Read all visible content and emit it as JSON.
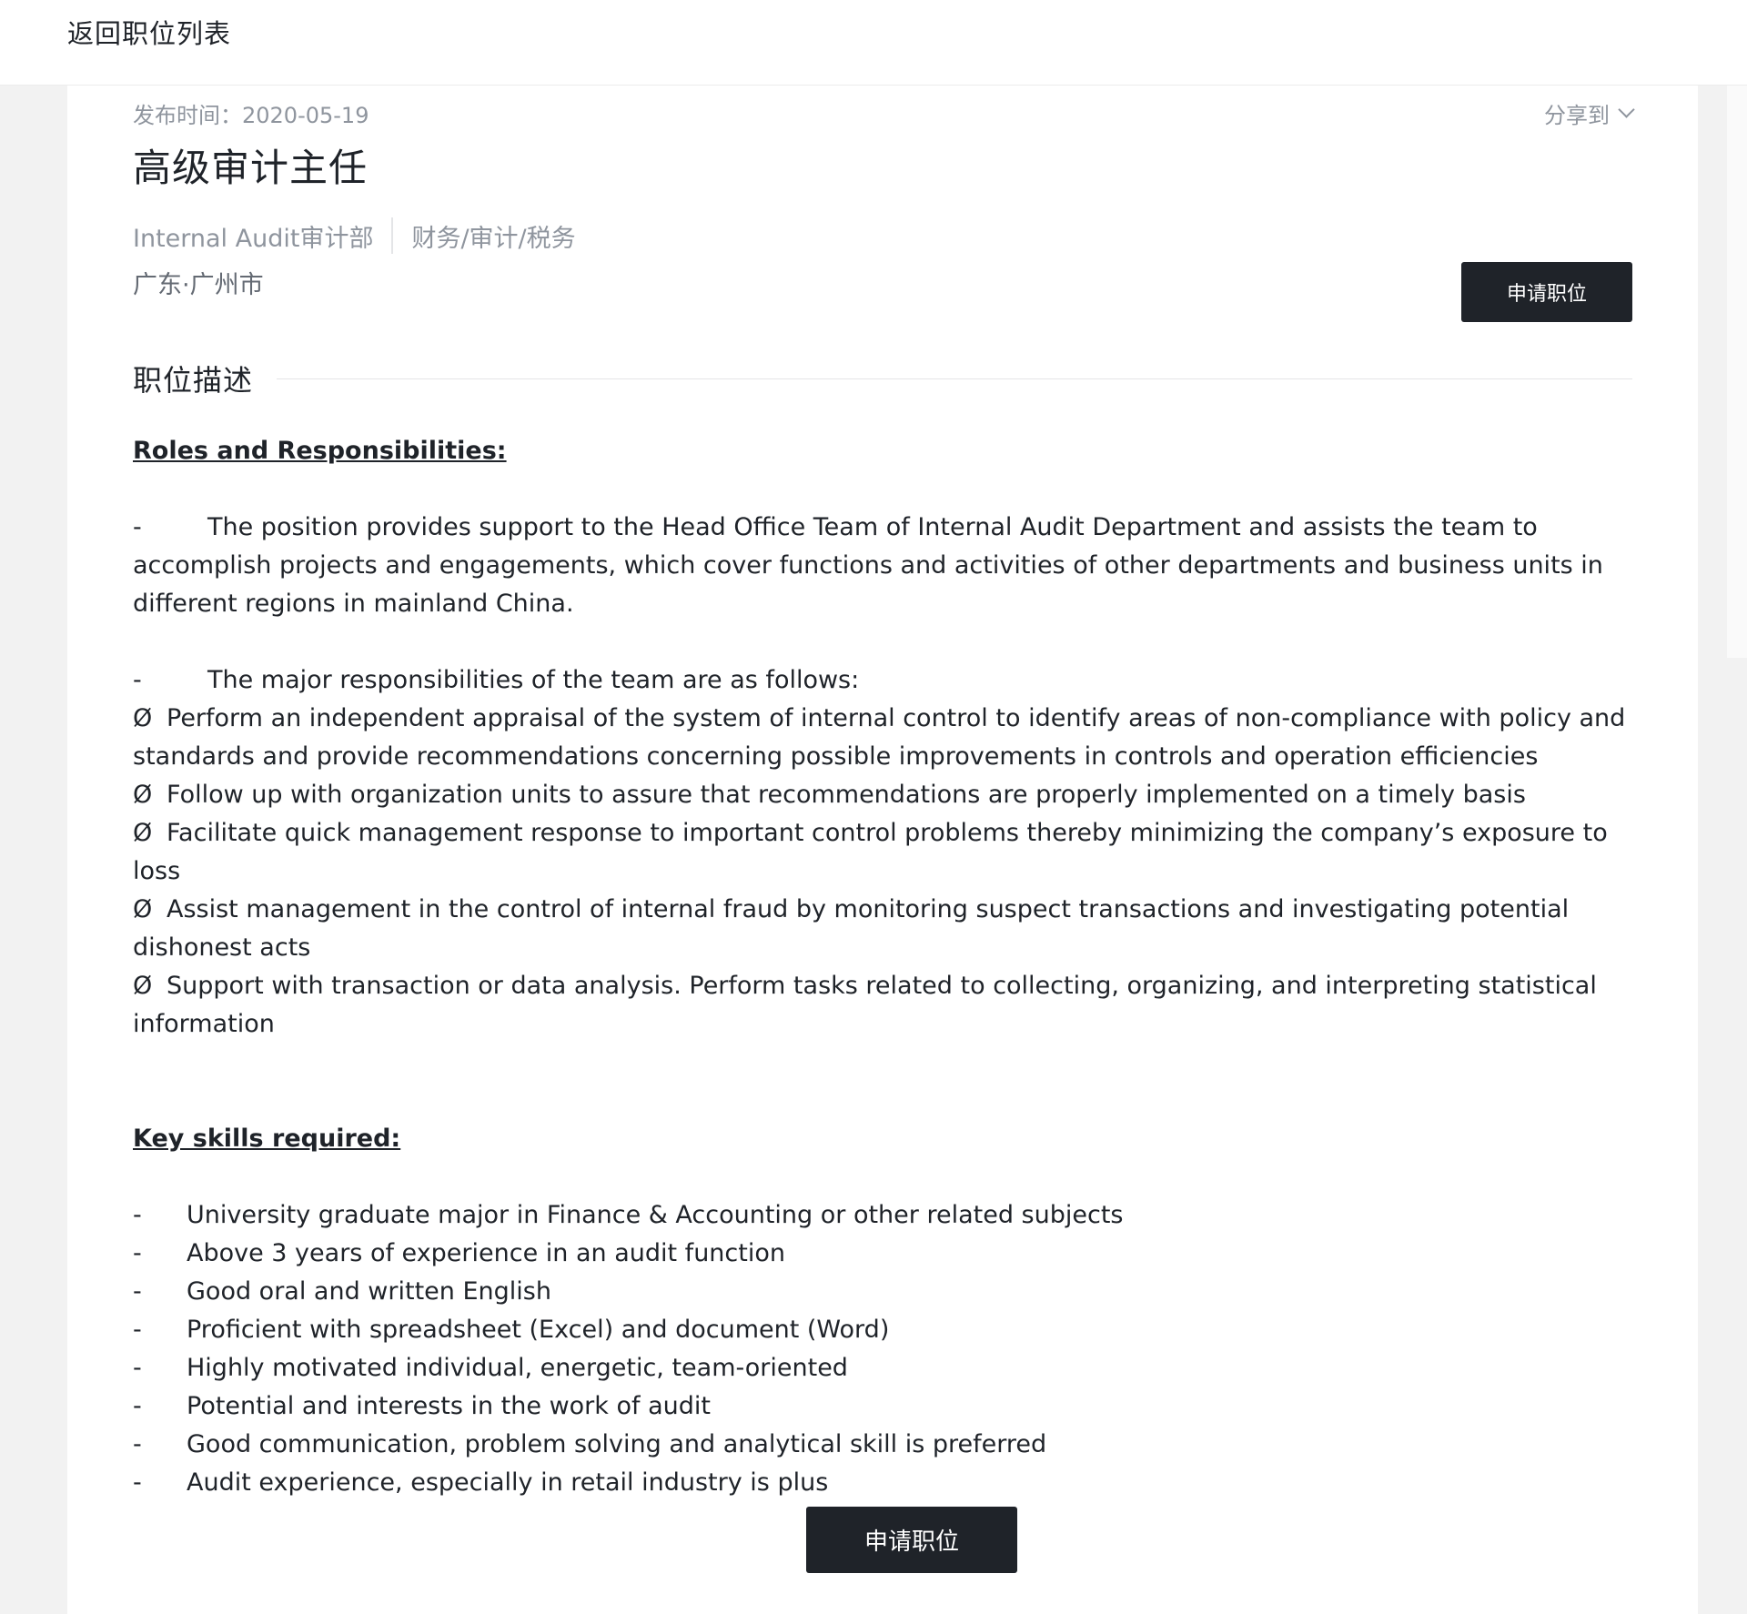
{
  "topbar": {
    "back_label": "返回职位列表"
  },
  "job": {
    "publish_time": "发布时间：2020-05-19",
    "share_label": "分享到",
    "title": "高级审计主任",
    "department": "Internal Audit审计部",
    "category": "财务/审计/税务",
    "location": "广东·广州市",
    "apply_label": "申请职位"
  },
  "description": {
    "section_title": "职位描述",
    "roles_heading": "Roles and Responsibilities:",
    "dash": "-",
    "bullet_mark": "Ø",
    "para1": "The position provides support to the Head Office Team of Internal Audit Department and assists the team to accomplish projects and engagements, which cover functions and activities of other departments and business units in different regions in mainland China.",
    "para2": "The major responsibilities of the team are as follows:",
    "responsibilities": [
      "Perform an independent appraisal of the system of internal control to identify areas of non-compliance with policy and standards and provide recommendations concerning possible improvements in controls and operation efficiencies",
      "Follow up with organization units to assure that recommendations are properly implemented on a timely basis",
      "Facilitate quick management response to important control problems thereby minimizing the company’s exposure to loss",
      "Assist management in the control of internal fraud by monitoring suspect transactions and investigating potential dishonest acts",
      "Support with transaction or data analysis. Perform tasks related to collecting, organizing, and interpreting statistical information"
    ],
    "skills_heading": "Key skills required:",
    "skills": [
      "University graduate major in Finance & Accounting or other related subjects",
      "Above 3 years of experience in an audit function",
      "Good oral and written English",
      "Proficient with spreadsheet (Excel) and document (Word)",
      "Highly motivated individual, energetic, team-oriented",
      "Potential and interests in the work of audit",
      "Good communication, problem solving and analytical skill is preferred",
      "Audit experience, especially in retail industry is plus"
    ]
  },
  "footer": {
    "apply_label": "申请职位"
  }
}
